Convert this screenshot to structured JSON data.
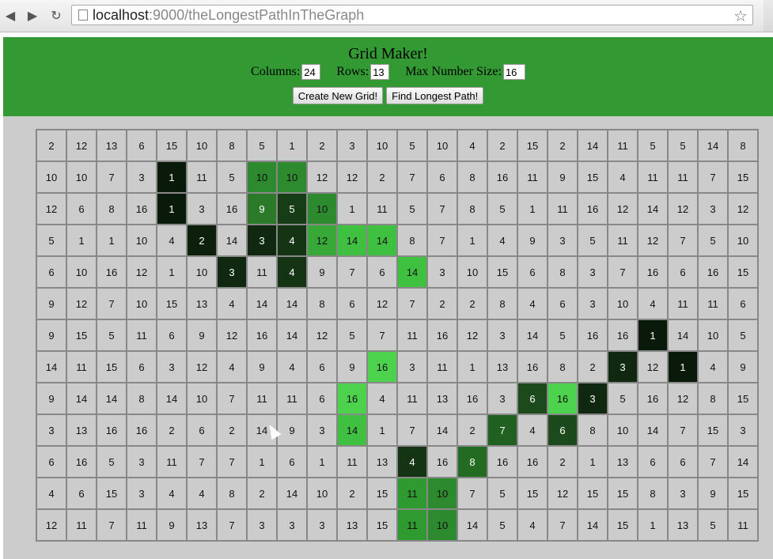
{
  "browser": {
    "url_host": "localhost",
    "url_port": ":9000",
    "url_path": "/theLongestPathInTheGraph"
  },
  "header": {
    "title": "Grid Maker!",
    "columns_label": "Columns:",
    "columns_value": "24",
    "rows_label": "Rows:",
    "rows_value": "13",
    "max_label": "Max Number Size:",
    "max_value": "16",
    "create_button": "Create New Grid!",
    "find_button": "Find Longest Path!"
  },
  "grid": {
    "columns": 24,
    "rows": [
      [
        2,
        12,
        13,
        6,
        15,
        10,
        8,
        5,
        1,
        2,
        3,
        10,
        5,
        10,
        4,
        2,
        15,
        2,
        14,
        11,
        5,
        5,
        14,
        8
      ],
      [
        10,
        10,
        7,
        3,
        1,
        11,
        5,
        10,
        10,
        12,
        12,
        2,
        7,
        6,
        8,
        16,
        11,
        9,
        15,
        4,
        11,
        11,
        7,
        15
      ],
      [
        12,
        6,
        8,
        16,
        1,
        3,
        16,
        9,
        5,
        10,
        1,
        11,
        5,
        7,
        8,
        5,
        1,
        11,
        16,
        12,
        14,
        12,
        3,
        12
      ],
      [
        5,
        1,
        1,
        10,
        4,
        2,
        14,
        3,
        4,
        12,
        14,
        14,
        8,
        7,
        1,
        4,
        9,
        3,
        5,
        11,
        12,
        7,
        5,
        10
      ],
      [
        6,
        10,
        16,
        12,
        1,
        10,
        3,
        11,
        4,
        9,
        7,
        6,
        14,
        3,
        10,
        15,
        6,
        8,
        3,
        7,
        16,
        6,
        16,
        15
      ],
      [
        9,
        12,
        7,
        10,
        15,
        13,
        4,
        14,
        14,
        8,
        6,
        12,
        7,
        2,
        2,
        8,
        4,
        6,
        3,
        10,
        4,
        11,
        11,
        6
      ],
      [
        9,
        15,
        5,
        11,
        6,
        9,
        12,
        16,
        14,
        12,
        5,
        7,
        11,
        16,
        12,
        3,
        14,
        5,
        16,
        16,
        1,
        14,
        10,
        5
      ],
      [
        14,
        11,
        15,
        6,
        3,
        12,
        4,
        9,
        4,
        6,
        9,
        16,
        3,
        11,
        1,
        13,
        16,
        8,
        2,
        3,
        12,
        1,
        4,
        9
      ],
      [
        9,
        14,
        14,
        8,
        14,
        10,
        7,
        11,
        11,
        6,
        16,
        4,
        11,
        13,
        16,
        3,
        6,
        16,
        3,
        5,
        16,
        12,
        8,
        15
      ],
      [
        3,
        13,
        16,
        16,
        2,
        6,
        2,
        14,
        9,
        3,
        14,
        1,
        7,
        14,
        2,
        7,
        4,
        6,
        8,
        10,
        14,
        7,
        15,
        3
      ],
      [
        6,
        16,
        5,
        3,
        11,
        7,
        7,
        1,
        6,
        1,
        11,
        13,
        4,
        16,
        8,
        16,
        16,
        2,
        1,
        13,
        6,
        6,
        7,
        14
      ],
      [
        4,
        6,
        15,
        3,
        4,
        4,
        8,
        2,
        14,
        10,
        2,
        15,
        11,
        10,
        7,
        5,
        15,
        12,
        15,
        15,
        8,
        3,
        9,
        15
      ],
      [
        12,
        11,
        7,
        11,
        9,
        13,
        7,
        3,
        3,
        3,
        13,
        15,
        11,
        10,
        14,
        5,
        4,
        7,
        14,
        15,
        1,
        13,
        5,
        11
      ]
    ],
    "highlight_colors": {
      "1": "#0a1a0a",
      "2": "#0c200c",
      "3": "#0f280f",
      "4": "#143414",
      "5": "#173d17",
      "6": "#1c4a1c",
      "7": "#206020",
      "8": "#236b23",
      "9": "#2a7a2a",
      "10": "#2e8a2e",
      "11": "#2f9a2f",
      "12": "#38a838",
      "13": "#3cb43c",
      "14": "#40c040",
      "16": "#4dd24d"
    },
    "highlighted": [
      [
        1,
        4
      ],
      [
        2,
        4
      ],
      [
        3,
        5
      ],
      [
        4,
        6
      ],
      [
        3,
        7
      ],
      [
        2,
        7
      ],
      [
        1,
        7
      ],
      [
        1,
        8
      ],
      [
        2,
        8
      ],
      [
        3,
        8
      ],
      [
        4,
        8
      ],
      [
        2,
        9
      ],
      [
        3,
        9
      ],
      [
        3,
        10
      ],
      [
        3,
        11
      ],
      [
        4,
        12
      ],
      [
        6,
        20
      ],
      [
        7,
        19
      ],
      [
        7,
        21
      ],
      [
        8,
        18
      ],
      [
        8,
        17
      ],
      [
        9,
        17
      ],
      [
        8,
        16
      ],
      [
        9,
        15
      ],
      [
        10,
        14
      ],
      [
        10,
        12
      ],
      [
        9,
        10
      ],
      [
        8,
        10
      ],
      [
        7,
        11
      ],
      [
        11,
        12
      ],
      [
        11,
        13
      ],
      [
        12,
        12
      ],
      [
        12,
        13
      ]
    ]
  }
}
